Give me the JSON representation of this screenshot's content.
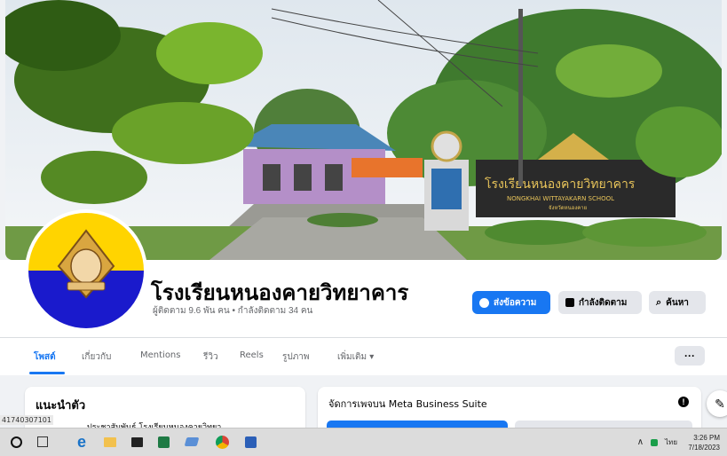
{
  "page": {
    "name": "โรงเรียนหนองคายวิทยาคาร",
    "stats": "ผู้ติดตาม 9.6 พัน คน • กำลังติดตาม 34 คน"
  },
  "cover": {
    "sign_thai": "โรงเรียนหนองคายวิทยาคาร",
    "sign_en": "NONGKHAI WITTAYAKARN SCHOOL",
    "sign_sub": "จังหวัดหนองคาย"
  },
  "actions": {
    "send_label": "ส่งข้อความ",
    "follow_label": "กำลังติดตาม",
    "search_label": "ค้นหา"
  },
  "tabs": [
    {
      "label": "โพสต์"
    },
    {
      "label": "เกี่ยวกับ"
    },
    {
      "label": "Mentions"
    },
    {
      "label": "รีวิว"
    },
    {
      "label": "Reels"
    },
    {
      "label": "รูปภาพ"
    },
    {
      "label": "เพิ่มเติม ▾"
    }
  ],
  "more_label": "···",
  "intro": {
    "title": "แนะนำตัว",
    "text": "ประชาสัมพันธ์ โรงเรียนหนองคายวิทยา"
  },
  "meta": {
    "title": "จัดการเพจบน Meta Business Suite"
  },
  "side_id": "41740307101",
  "taskbar": {
    "tray_lang": "ไทย",
    "time": "3:26 PM",
    "date": "7/18/2023"
  },
  "colors": {
    "accent": "#1877f2",
    "avatar_yellow": "#ffd400",
    "avatar_blue": "#1a1acc"
  }
}
